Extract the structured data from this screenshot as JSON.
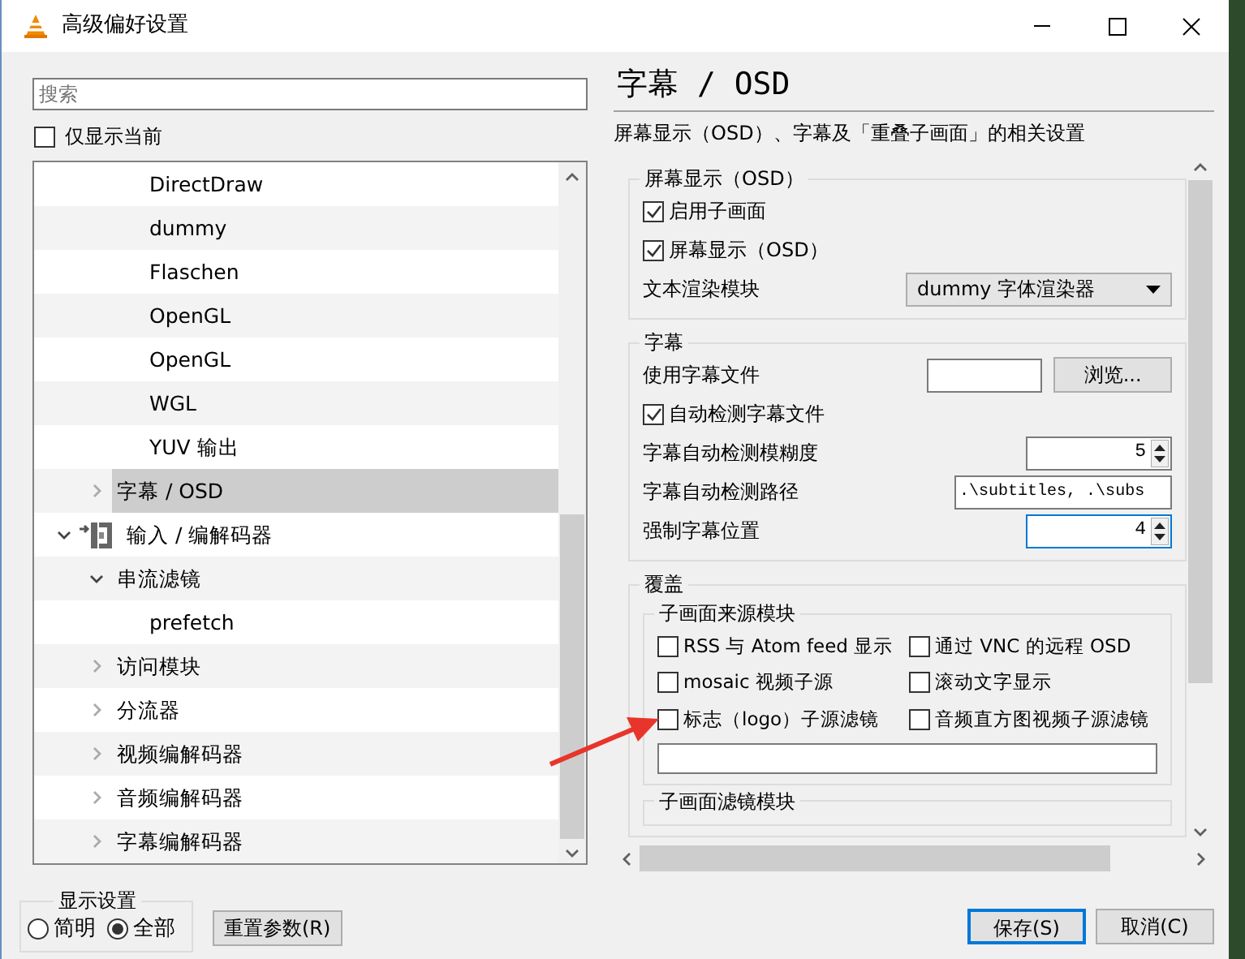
{
  "window": {
    "title": "高级偏好设置"
  },
  "search": {
    "placeholder": "搜索"
  },
  "show_current": {
    "label": "仅显示当前",
    "checked": false
  },
  "tree": {
    "items": [
      {
        "label": "DirectDraw",
        "kind": "module",
        "selected": false
      },
      {
        "label": "dummy",
        "kind": "module",
        "selected": false
      },
      {
        "label": "Flaschen",
        "kind": "module",
        "selected": false
      },
      {
        "label": "OpenGL",
        "kind": "module",
        "selected": false
      },
      {
        "label": "OpenGL",
        "kind": "module",
        "selected": false
      },
      {
        "label": "WGL",
        "kind": "module",
        "selected": false
      },
      {
        "label": "YUV 输出",
        "kind": "module",
        "selected": false
      },
      {
        "label": "字幕 / OSD",
        "kind": "subcategory",
        "expanded": false,
        "selected": true
      },
      {
        "label": "输入 / 编解码器",
        "kind": "category",
        "expanded": true,
        "selected": false,
        "children": [
          {
            "label": "串流滤镜",
            "kind": "subcategory",
            "expanded": true,
            "selected": false,
            "children": [
              {
                "label": "prefetch",
                "kind": "module",
                "selected": false
              }
            ]
          },
          {
            "label": "访问模块",
            "kind": "subcategory",
            "expanded": false,
            "selected": false
          },
          {
            "label": "分流器",
            "kind": "subcategory",
            "expanded": false,
            "selected": false
          },
          {
            "label": "视频编解码器",
            "kind": "subcategory",
            "expanded": false,
            "selected": false
          },
          {
            "label": "音频编解码器",
            "kind": "subcategory",
            "expanded": false,
            "selected": false
          },
          {
            "label": "字幕编解码器",
            "kind": "subcategory",
            "expanded": false,
            "selected": false
          }
        ]
      }
    ]
  },
  "display_settings": {
    "title": "显示设置",
    "options": [
      {
        "label": "简明",
        "selected": false
      },
      {
        "label": "全部",
        "selected": true
      }
    ]
  },
  "reset_button": "重置参数(R)",
  "panel": {
    "title": "字幕 / OSD",
    "description": "屏幕显示（OSD）、字幕及「重叠子画面」的相关设置",
    "groups": [
      {
        "title": "屏幕显示（OSD）",
        "rows": [
          {
            "kind": "checkbox",
            "label": "启用子画面",
            "checked": true
          },
          {
            "kind": "checkbox",
            "label": "屏幕显示（OSD）",
            "checked": true
          },
          {
            "kind": "select",
            "label": "文本渲染模块",
            "value": "dummy 字体渲染器"
          }
        ]
      },
      {
        "title": "字幕",
        "rows": [
          {
            "kind": "file",
            "label": "使用字幕文件",
            "button": "浏览..."
          },
          {
            "kind": "checkbox",
            "label": "自动检测字幕文件",
            "checked": true
          },
          {
            "kind": "spin",
            "label": "字幕自动检测模糊度",
            "value": "5",
            "focused": false
          },
          {
            "kind": "text",
            "label": "字幕自动检测路径",
            "value": ".\\subtitles, .\\subs"
          },
          {
            "kind": "spin",
            "label": "强制字幕位置",
            "value": "4",
            "focused": true
          }
        ]
      },
      {
        "title": "覆盖",
        "subgroups": [
          {
            "title": "子画面来源模块",
            "options": [
              {
                "label": "RSS 与 Atom feed 显示",
                "checked": false
              },
              {
                "label": "通过 VNC 的远程 OSD",
                "checked": false
              },
              {
                "label": "mosaic 视频子源",
                "checked": false
              },
              {
                "label": "滚动文字显示",
                "checked": false
              },
              {
                "label": "标志（logo）子源滤镜",
                "checked": false
              },
              {
                "label": "音频直方图视频子源滤镜",
                "checked": false
              }
            ]
          },
          {
            "title": "子画面滤镜模块"
          }
        ]
      }
    ]
  },
  "buttons": [
    {
      "label": "保存(S)",
      "default": true
    },
    {
      "label": "取消(C)",
      "default": false
    }
  ]
}
